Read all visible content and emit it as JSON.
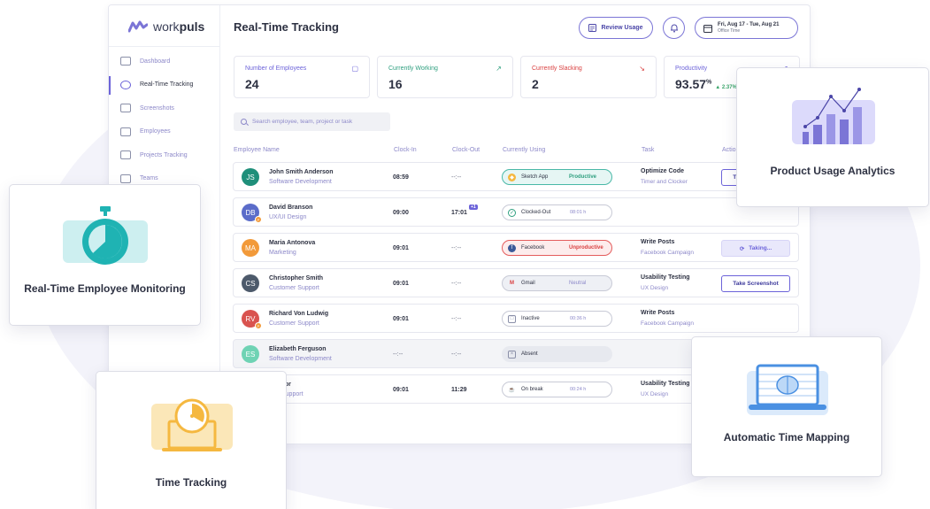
{
  "app": {
    "logo_prefix": "work",
    "logo_bold": "puls",
    "page_title": "Real-Time Tracking",
    "review_label": "Review Usage",
    "date_range": "Fri, Aug 17 - Tue, Aug 21",
    "date_sub": "Office Time"
  },
  "sidebar": {
    "items": [
      {
        "label": "Dashboard",
        "icon": "dashboard-icon"
      },
      {
        "label": "Real-Time Tracking",
        "icon": "clock-icon",
        "active": true
      },
      {
        "label": "Screenshots",
        "icon": "image-icon"
      },
      {
        "label": "Employees",
        "icon": "users-icon"
      },
      {
        "label": "Projects Tracking",
        "icon": "briefcase-icon"
      },
      {
        "label": "Teams",
        "icon": "teams-icon"
      }
    ]
  },
  "stats": [
    {
      "label": "Number of Employees",
      "value": "24",
      "color": "#6c63d9",
      "icon": "briefcase-icon"
    },
    {
      "label": "Currently Working",
      "value": "16",
      "color": "#2e9f7f",
      "icon": "trend-up-icon"
    },
    {
      "label": "Currently Slacking",
      "value": "2",
      "color": "#d94040",
      "icon": "trend-down-icon"
    },
    {
      "label": "Productivity",
      "value": "93.57",
      "unit": "%",
      "delta": "▲ 2.37%",
      "color": "#6c63d9",
      "icon": "trend-up-icon"
    }
  ],
  "search": {
    "placeholder": "Search employee, team, project or task"
  },
  "table": {
    "headers": [
      "Employee Name",
      "Clock-In",
      "Clock-Out",
      "Currently Using",
      "Task",
      "Action"
    ],
    "rows": [
      {
        "initials": "JS",
        "avatar_color": "#1f8f7a",
        "name": "John Smith Anderson",
        "dept": "Software Development",
        "clock_in": "08:59",
        "clock_out": "--:--",
        "app": "Sketch App",
        "app_icon": "sketch-icon",
        "state": "Productive",
        "kind": "productive",
        "task": "Optimize Code",
        "task_sub": "Timer and Clocker",
        "action": "Take Screenshot"
      },
      {
        "initials": "DB",
        "avatar_color": "#5b6cc9",
        "name": "David Branson",
        "dept": "UX/UI Design",
        "clock_in": "09:00",
        "clock_out": "17:01",
        "clock_out_badge": "+1",
        "app": "Clocked-Out",
        "app_icon": "check-circle-icon",
        "duration": "08:01 h",
        "kind": "plain",
        "task": "",
        "task_sub": "",
        "action": ""
      },
      {
        "initials": "MA",
        "avatar_color": "#f29a3a",
        "name": "Maria Antonova",
        "dept": "Marketing",
        "clock_in": "09:01",
        "clock_out": "--:--",
        "app": "Facebook",
        "app_icon": "facebook-icon",
        "state": "Unproductive",
        "kind": "unproductive",
        "task": "Write Posts",
        "task_sub": "Facebook Campaign",
        "action": "Taking..."
      },
      {
        "initials": "CS",
        "avatar_color": "#4d5a6b",
        "name": "Christopher Smith",
        "dept": "Customer Support",
        "clock_in": "09:01",
        "clock_out": "--:--",
        "app": "Gmail",
        "app_icon": "gmail-icon",
        "state": "Neutral",
        "kind": "neutral",
        "task": "Usability Testing",
        "task_sub": "UX Design",
        "action": "Take Screenshot"
      },
      {
        "initials": "RV",
        "avatar_color": "#d9534f",
        "name": "Richard Von Ludwig",
        "dept": "Customer Support",
        "clock_in": "09:01",
        "clock_out": "--:--",
        "app": "Inactive",
        "app_icon": "inactive-icon",
        "duration": "00:36 h",
        "kind": "plain",
        "task": "Write Posts",
        "task_sub": "Facebook Campaign",
        "action": ""
      },
      {
        "initials": "ES",
        "avatar_color": "#6fd3b4",
        "name": "Elizabeth Ferguson",
        "dept": "Software Development",
        "clock_in": "--:--",
        "clock_out": "--:--",
        "app": "Absent",
        "app_icon": "absent-icon",
        "kind": "absent",
        "task": "",
        "task_sub": "",
        "action": ""
      },
      {
        "initials": "",
        "avatar_color": "#8c88c9",
        "name": "Connor",
        "dept": "mer Support",
        "clock_in": "09:01",
        "clock_out": "11:29",
        "app": "On break",
        "app_icon": "coffee-icon",
        "duration": "00:24 h",
        "kind": "plain",
        "task": "Usability Testing",
        "task_sub": "UX Design",
        "action": ""
      }
    ]
  },
  "cards": {
    "monitoring": "Real-Time Employee Monitoring",
    "time_tracking": "Time Tracking",
    "analytics": "Product Usage Analytics",
    "mapping": "Automatic Time Mapping"
  },
  "colors": {
    "accent": "#6c63d9",
    "teal": "#2cc4b4",
    "orange": "#f5b840"
  }
}
